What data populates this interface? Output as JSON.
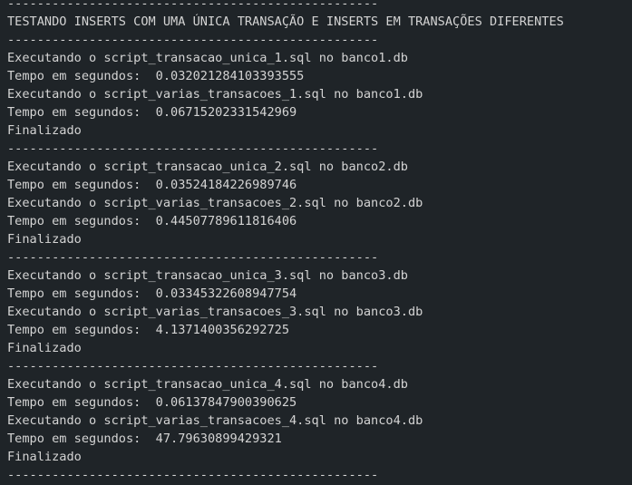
{
  "terminal": {
    "colors": {
      "background": "#1f2428",
      "text": "#d4d4d4"
    },
    "lines": [
      "--------------------------------------------------",
      "TESTANDO INSERTS COM UMA ÚNICA TRANSAÇÃO E INSERTS EM TRANSAÇÕES DIFERENTES",
      "--------------------------------------------------",
      "Executando o script_transacao_unica_1.sql no banco1.db",
      "Tempo em segundos:  0.032021284103393555",
      "Executando o script_varias_transacoes_1.sql no banco1.db",
      "Tempo em segundos:  0.06715202331542969",
      "Finalizado",
      "--------------------------------------------------",
      "Executando o script_transacao_unica_2.sql no banco2.db",
      "Tempo em segundos:  0.03524184226989746",
      "Executando o script_varias_transacoes_2.sql no banco2.db",
      "Tempo em segundos:  0.44507789611816406",
      "Finalizado",
      "--------------------------------------------------",
      "Executando o script_transacao_unica_3.sql no banco3.db",
      "Tempo em segundos:  0.03345322608947754",
      "Executando o script_varias_transacoes_3.sql no banco3.db",
      "Tempo em segundos:  4.1371400356292725",
      "Finalizado",
      "--------------------------------------------------",
      "Executando o script_transacao_unica_4.sql no banco4.db",
      "Tempo em segundos:  0.06137847900390625",
      "Executando o script_varias_transacoes_4.sql no banco4.db",
      "Tempo em segundos:  47.79630899429321",
      "Finalizado",
      "--------------------------------------------------"
    ]
  }
}
